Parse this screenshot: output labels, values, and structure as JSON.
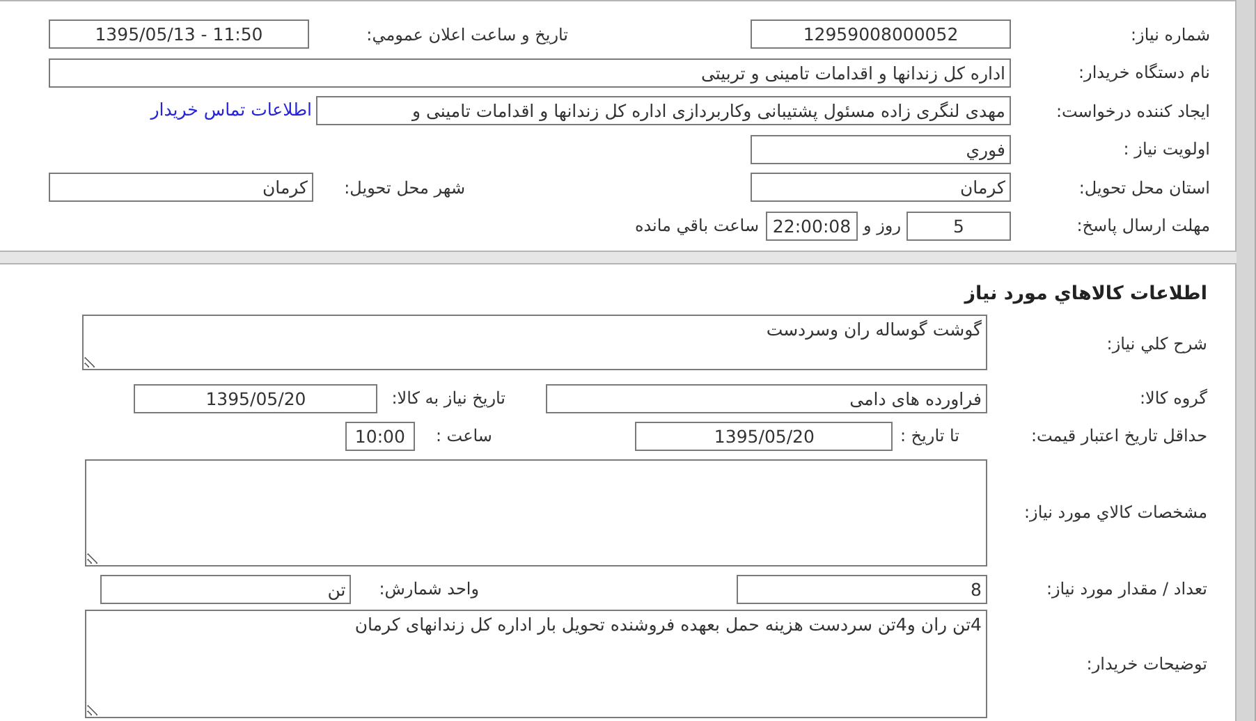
{
  "need_info": {
    "need_number": {
      "label": "شماره نیاز:",
      "value": "12959008000052"
    },
    "announce_datetime": {
      "label": "تاریخ و ساعت اعلان عمومي:",
      "value": "1395/05/13 - 11:50"
    },
    "buyer_org": {
      "label": "نام دستگاه خریدار:",
      "value": "اداره کل زندانها و اقدامات تامینی و تربیتی"
    },
    "requester": {
      "label": "ایجاد کننده درخواست:",
      "value": "مهدی لنگری زاده مسئول پشتیبانی وکاربردازی اداره کل زندانها و اقدامات تامینی و",
      "link": "اطلاعات تماس خریدار"
    },
    "priority": {
      "label": "اولویت نیاز :",
      "value": "فوري"
    },
    "delivery_province": {
      "label": "استان محل تحویل:",
      "value": "کرمان"
    },
    "delivery_city": {
      "label": "شهر محل تحویل:",
      "value": "کرمان"
    },
    "deadline": {
      "label": "مهلت ارسال پاسخ:",
      "days": "5",
      "days_suffix": "روز و",
      "time": "22:00:08",
      "time_suffix": "ساعت باقي مانده"
    }
  },
  "goods_info": {
    "title": "اطلاعات کالاهاي مورد نياز",
    "description": {
      "label": "شرح کلي نیاز:",
      "value": "گوشت گوساله ران وسردست"
    },
    "group": {
      "label": "گروه کالا:",
      "value": "فراورده های دامی"
    },
    "need_date": {
      "label": "تاریخ نیاز به کالا:",
      "value": "1395/05/20"
    },
    "price_validity": {
      "label": "حداقل تاریخ اعتبار قیمت:",
      "to_label": "تا تاریخ :",
      "date": "1395/05/20",
      "time_label": "ساعت :",
      "time": "10:00"
    },
    "specs": {
      "label": "مشخصات کالاي مورد نياز:"
    },
    "quantity": {
      "label": "تعداد / مقدار مورد نیاز:",
      "value": "8"
    },
    "unit": {
      "label": "واحد شمارش:",
      "value": "تن"
    },
    "buyer_notes": {
      "label": "توضیحات خریدار:",
      "value": "4تن ران و4تن سردست هزینه حمل بعهده فروشنده تحویل بار اداره کل زندانهای کرمان"
    }
  }
}
